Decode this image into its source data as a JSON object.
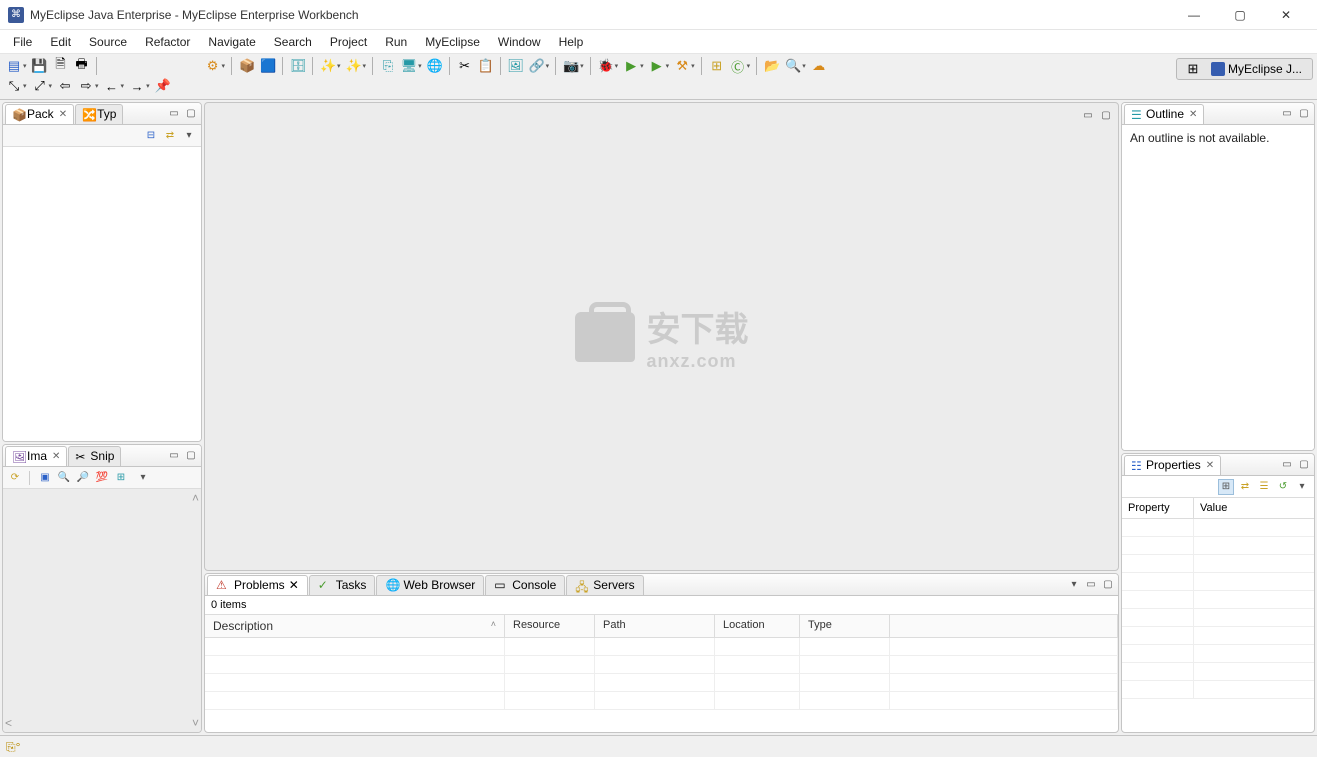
{
  "window": {
    "title": "MyEclipse Java Enterprise - MyEclipse Enterprise Workbench"
  },
  "menubar": [
    "File",
    "Edit",
    "Source",
    "Refactor",
    "Navigate",
    "Search",
    "Project",
    "Run",
    "MyEclipse",
    "Window",
    "Help"
  ],
  "perspective": {
    "open_label": "",
    "current": "MyEclipse J..."
  },
  "left": {
    "top_tabs": [
      {
        "label": "Pack",
        "icon": "package-explorer-icon",
        "closable": true
      },
      {
        "label": "Typ",
        "icon": "type-hierarchy-icon",
        "closable": false
      }
    ],
    "bot_tabs": [
      {
        "label": "Ima",
        "icon": "image-icon",
        "closable": true
      },
      {
        "label": "Snip",
        "icon": "snippets-icon",
        "closable": false
      }
    ]
  },
  "bottom": {
    "tabs": [
      {
        "label": "Problems",
        "icon": "problems-icon",
        "active": true,
        "closable": true
      },
      {
        "label": "Tasks",
        "icon": "tasks-icon"
      },
      {
        "label": "Web Browser",
        "icon": "browser-icon"
      },
      {
        "label": "Console",
        "icon": "console-icon"
      },
      {
        "label": "Servers",
        "icon": "servers-icon"
      }
    ],
    "items_summary": "0 items",
    "columns": [
      "Description",
      "Resource",
      "Path",
      "Location",
      "Type"
    ]
  },
  "right": {
    "outline_tab": "Outline",
    "outline_msg": "An outline is not available.",
    "properties_tab": "Properties",
    "prop_columns": [
      "Property",
      "Value"
    ]
  },
  "watermark": {
    "text": "安下载",
    "sub": "anxz.com"
  }
}
